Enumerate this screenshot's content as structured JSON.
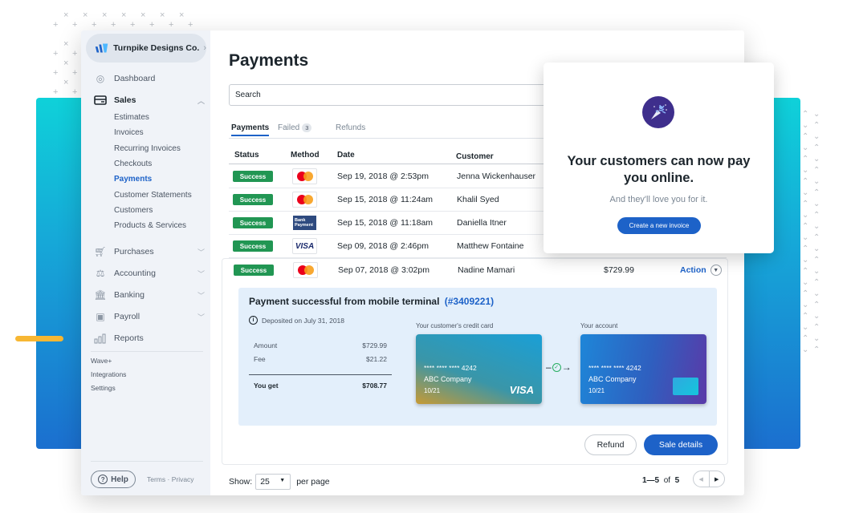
{
  "business": {
    "name": "Turnpike Designs Co."
  },
  "sidebar": {
    "nav": [
      {
        "label": "Dashboard",
        "icon": "dashboard-icon"
      },
      {
        "label": "Sales",
        "icon": "sales-card-icon",
        "expanded": true
      },
      {
        "label": "Purchases",
        "icon": "cart-icon"
      },
      {
        "label": "Accounting",
        "icon": "scale-icon"
      },
      {
        "label": "Banking",
        "icon": "bank-icon"
      },
      {
        "label": "Payroll",
        "icon": "payroll-icon"
      },
      {
        "label": "Reports",
        "icon": "bar-chart-icon"
      }
    ],
    "sales_sub": [
      "Estimates",
      "Invoices",
      "Recurring Invoices",
      "Checkouts",
      "Payments",
      "Customer Statements",
      "Customers",
      "Products & Services"
    ],
    "active_sub": "Payments",
    "extras": [
      "Wave+",
      "Integrations",
      "Settings"
    ],
    "help_label": "Help",
    "legal": "Terms · Privacy"
  },
  "main": {
    "title": "Payments",
    "search_placeholder": "Search",
    "tabs": [
      {
        "label": "Payments",
        "active": true
      },
      {
        "label": "Failed",
        "badge": "3"
      },
      {
        "label": "Refunds"
      }
    ],
    "columns": [
      "Status",
      "Method",
      "Date",
      "Customer"
    ],
    "rows": [
      {
        "status": "Success",
        "method": "mastercard",
        "date": "Sep 19, 2018 @ 2:53pm",
        "customer": "Jenna Wickenhauser"
      },
      {
        "status": "Success",
        "method": "mastercard",
        "date": "Sep 15, 2018 @ 11:24am",
        "customer": "Khalil Syed"
      },
      {
        "status": "Success",
        "method": "bank",
        "date": "Sep 15, 2018 @ 11:18am",
        "customer": "Daniella Itner"
      },
      {
        "status": "Success",
        "method": "visa",
        "date": "Sep 09, 2018 @ 2:46pm",
        "customer": "Matthew Fontaine"
      },
      {
        "status": "Success",
        "method": "mastercard",
        "date": "Sep 07, 2018 @ 3:02pm",
        "customer": "Nadine Mamari",
        "amount": "$729.99",
        "action": "Action"
      }
    ],
    "method_labels": {
      "bank": "Bank Payment",
      "visa": "VISA"
    },
    "detail": {
      "title": "Payment successful from mobile terminal",
      "ref": "(#3409221)",
      "deposit": "Deposited on July 31, 2018",
      "amount_label": "Amount",
      "amount": "$729.99",
      "fee_label": "Fee",
      "fee": "$21.22",
      "you_get_label": "You get",
      "you_get": "$708.77",
      "customer_card_label": "Your customer's credit card",
      "account_label": "Your account",
      "customer_card": {
        "number": "**** **** **** 4242",
        "company": "ABC Company",
        "expiry": "10/21",
        "brand": "VISA"
      },
      "account_card": {
        "number": "**** **** **** 4242",
        "company": "ABC Company",
        "expiry": "10/21"
      },
      "refund_label": "Refund",
      "sale_details_label": "Sale details"
    },
    "footer": {
      "show_label": "Show:",
      "per_page_value": "25",
      "per_page_label": "per page",
      "range": "1—5",
      "of_label": "of",
      "total": "5"
    }
  },
  "promo": {
    "title": "Your customers can now pay you online.",
    "subtitle": "And they'll love you for it.",
    "button": "Create a new invoice"
  },
  "colors": {
    "accent": "#1d62c8",
    "success": "#219653",
    "promo_icon_bg": "#3e2e8c",
    "highlight_bar": "#f7b733"
  }
}
